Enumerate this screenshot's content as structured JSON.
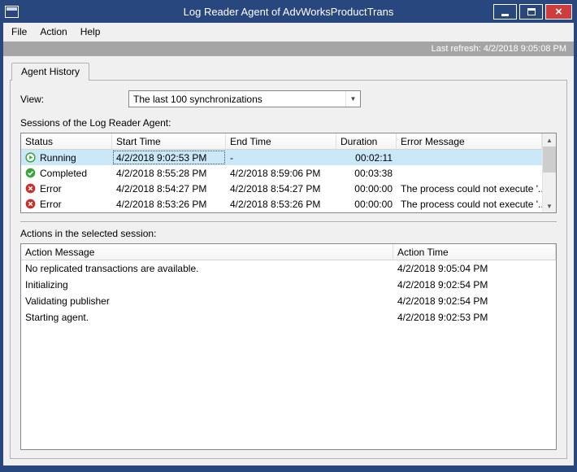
{
  "window": {
    "title": "Log Reader Agent of AdvWorksProductTrans"
  },
  "menu": {
    "items": [
      {
        "label": "File"
      },
      {
        "label": "Action"
      },
      {
        "label": "Help"
      }
    ]
  },
  "status_bar": {
    "last_refresh": "Last refresh: 4/2/2018 9:05:08 PM"
  },
  "tabs": [
    {
      "label": "Agent History"
    }
  ],
  "view": {
    "label": "View:",
    "selected": "The last 100 synchronizations"
  },
  "icons": {
    "dropdown": "▼",
    "scroll_up": "▲",
    "scroll_down": "▼",
    "close": "×"
  },
  "colors": {
    "titlebar": "#27477e",
    "close_button": "#ce3c3c",
    "selection": "#cbe8f9",
    "running_green": "#3aa63a",
    "completed_green": "#3aa63a",
    "error_red": "#c9302c",
    "refresh_strip": "#a5a5a5"
  },
  "sessions": {
    "label": "Sessions of the Log Reader Agent:",
    "columns": [
      "Status",
      "Start Time",
      "End Time",
      "Duration",
      "Error Message"
    ],
    "rows": [
      {
        "status": "Running",
        "icon": "running",
        "start": "4/2/2018 9:02:53 PM",
        "end": "-",
        "duration": "00:02:11",
        "error": "",
        "selected": true
      },
      {
        "status": "Completed",
        "icon": "completed",
        "start": "4/2/2018 8:55:28 PM",
        "end": "4/2/2018 8:59:06 PM",
        "duration": "00:03:38",
        "error": "",
        "selected": false
      },
      {
        "status": "Error",
        "icon": "error",
        "start": "4/2/2018 8:54:27 PM",
        "end": "4/2/2018 8:54:27 PM",
        "duration": "00:00:00",
        "error": "The process could not execute '...",
        "selected": false
      },
      {
        "status": "Error",
        "icon": "error",
        "start": "4/2/2018 8:53:26 PM",
        "end": "4/2/2018 8:53:26 PM",
        "duration": "00:00:00",
        "error": "The process could not execute '...",
        "selected": false
      }
    ]
  },
  "actions": {
    "label": "Actions in the selected session:",
    "columns": [
      "Action Message",
      "Action Time"
    ],
    "rows": [
      {
        "message": "No replicated transactions are available.",
        "time": "4/2/2018 9:05:04 PM"
      },
      {
        "message": "Initializing",
        "time": "4/2/2018 9:02:54 PM"
      },
      {
        "message": "Validating publisher",
        "time": "4/2/2018 9:02:54 PM"
      },
      {
        "message": "Starting agent.",
        "time": "4/2/2018 9:02:53 PM"
      }
    ]
  }
}
